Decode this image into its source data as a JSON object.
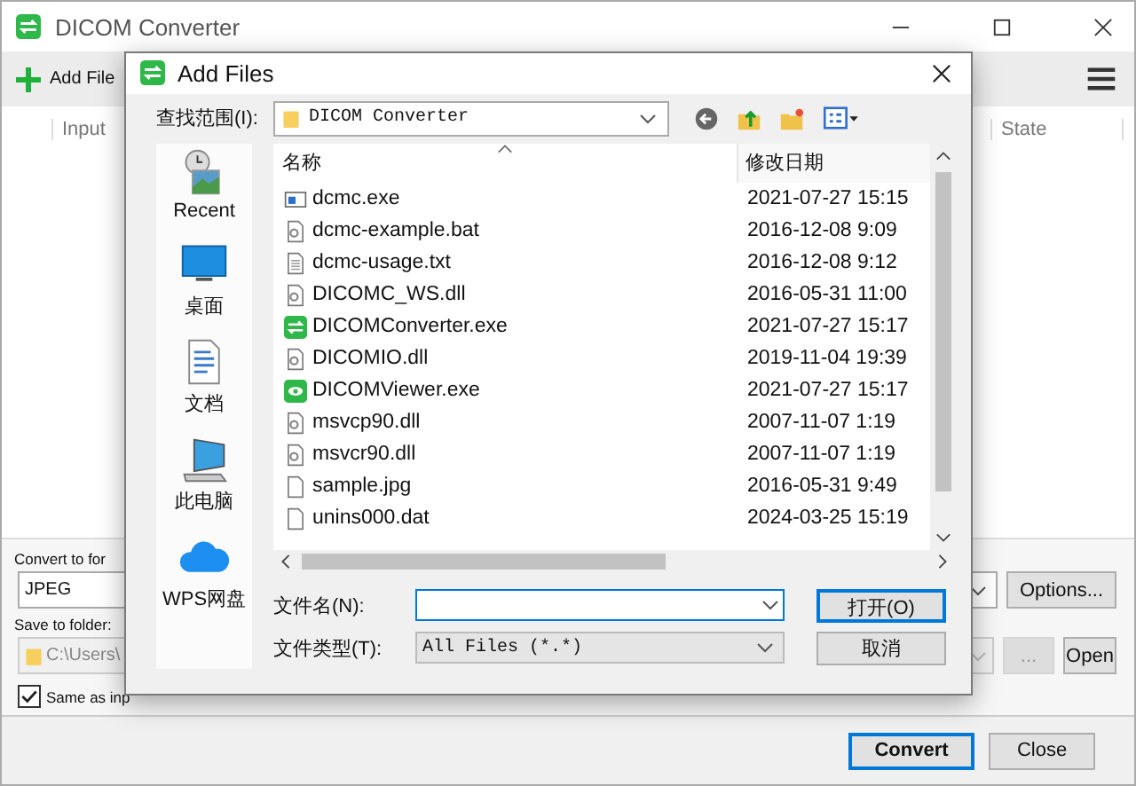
{
  "main_window": {
    "title": "DICOM Converter",
    "add_files": "Add File",
    "columns": [
      "Input",
      "State"
    ],
    "convert_to_label": "Convert to for",
    "format_value": "JPEG",
    "options_button": "Options...",
    "save_to_label": "Save to folder:",
    "folder": {
      "value": "C:\\Users\\",
      "disabled": true
    },
    "browse_button": {
      "label": "...",
      "disabled": true
    },
    "open_button": "Open",
    "same_as_input": {
      "label": "Same as inp",
      "checked": true
    },
    "buttons": [
      {
        "label": "Convert",
        "default": true
      },
      {
        "label": "Close",
        "default": false
      }
    ]
  },
  "dialog": {
    "title": "Add Files",
    "look_in_label": "查找范围(I):",
    "look_in_value": "DICOM Converter",
    "places": [
      {
        "label": "Recent",
        "kind": "recent"
      },
      {
        "label": "桌面",
        "kind": "desktop"
      },
      {
        "label": "文档",
        "kind": "documents"
      },
      {
        "label": "此电脑",
        "kind": "computer"
      },
      {
        "label": "WPS网盘",
        "kind": "cloud"
      }
    ],
    "columns": [
      "名称",
      "修改日期"
    ],
    "files": [
      {
        "name": "dcmc.exe",
        "date": "2021-07-27 15:15",
        "kind": "exe"
      },
      {
        "name": "dcmc-example.bat",
        "date": "2016-12-08 9:09",
        "kind": "gear"
      },
      {
        "name": "dcmc-usage.txt",
        "date": "2016-12-08 9:12",
        "kind": "text"
      },
      {
        "name": "DICOMC_WS.dll",
        "date": "2016-05-31 11:00",
        "kind": "gear"
      },
      {
        "name": "DICOMConverter.exe",
        "date": "2021-07-27 15:17",
        "kind": "converter"
      },
      {
        "name": "DICOMIO.dll",
        "date": "2019-11-04 19:39",
        "kind": "gear"
      },
      {
        "name": "DICOMViewer.exe",
        "date": "2021-07-27 15:17",
        "kind": "viewer"
      },
      {
        "name": "msvcp90.dll",
        "date": "2007-11-07 1:19",
        "kind": "gear"
      },
      {
        "name": "msvcr90.dll",
        "date": "2007-11-07 1:19",
        "kind": "gear"
      },
      {
        "name": "sample.jpg",
        "date": "2016-05-31 9:49",
        "kind": "blank"
      },
      {
        "name": "unins000.dat",
        "date": "2024-03-25 15:19",
        "kind": "blank"
      }
    ],
    "file_name_label": "文件名(N):",
    "file_type_label": "文件类型(T):",
    "file_type_value": "All Files (*.*)",
    "buttons": [
      {
        "label": "打开(O)",
        "default": true
      },
      {
        "label": "取消",
        "default": false
      }
    ]
  }
}
